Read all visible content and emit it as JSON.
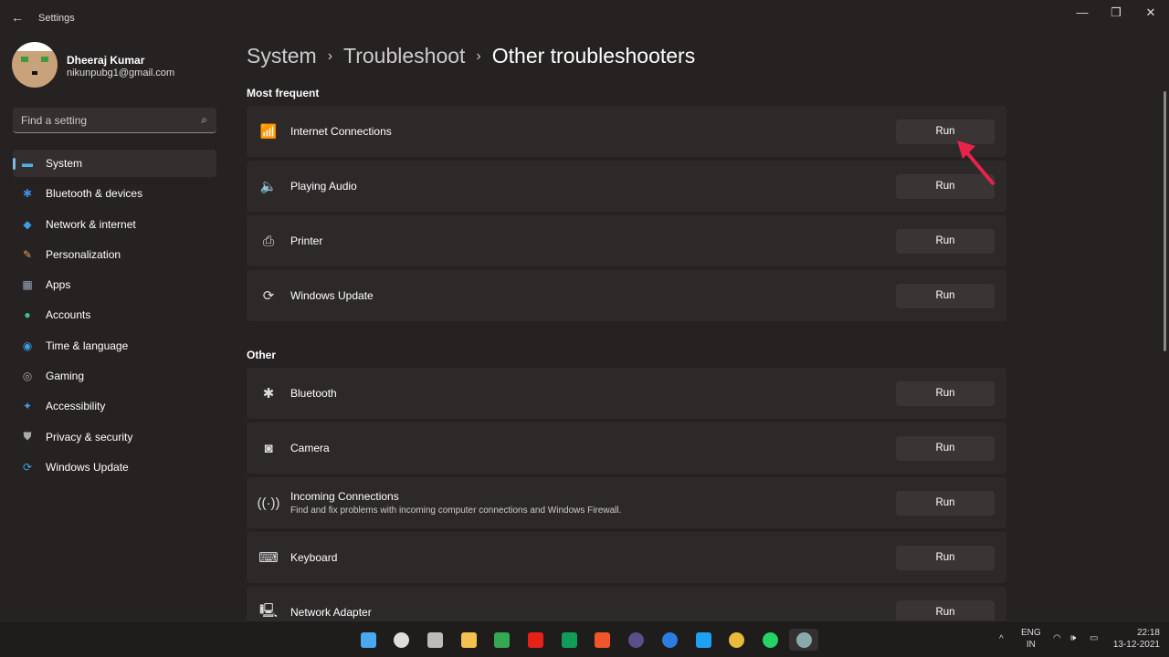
{
  "window": {
    "title": "Settings",
    "back": "←",
    "minimize": "—",
    "maximize": "❐",
    "close": "✕"
  },
  "user": {
    "name": "Dheeraj Kumar",
    "email": "nikunpubg1@gmail.com"
  },
  "search": {
    "placeholder": "Find a setting",
    "icon": "⌕"
  },
  "nav": [
    {
      "label": "System",
      "icon": "▬",
      "color": "#4cb2e8"
    },
    {
      "label": "Bluetooth & devices",
      "icon": "✱",
      "color": "#3a8ee6"
    },
    {
      "label": "Network & internet",
      "icon": "◆",
      "color": "#3aa0e6"
    },
    {
      "label": "Personalization",
      "icon": "✎",
      "color": "#e89a5a"
    },
    {
      "label": "Apps",
      "icon": "▦",
      "color": "#9ab"
    },
    {
      "label": "Accounts",
      "icon": "●",
      "color": "#3fc28a"
    },
    {
      "label": "Time & language",
      "icon": "◉",
      "color": "#3aa0e6"
    },
    {
      "label": "Gaming",
      "icon": "◎",
      "color": "#aaa"
    },
    {
      "label": "Accessibility",
      "icon": "✦",
      "color": "#3aa0e6"
    },
    {
      "label": "Privacy & security",
      "icon": "⛊",
      "color": "#aaa"
    },
    {
      "label": "Windows Update",
      "icon": "⟳",
      "color": "#3aa0e6"
    }
  ],
  "breadcrumb": [
    "System",
    "Troubleshoot",
    "Other troubleshooters"
  ],
  "breadcrumb_sep": "›",
  "sections": {
    "frequent": "Most frequent",
    "other": "Other"
  },
  "run_label": "Run",
  "frequent": [
    {
      "title": "Internet Connections",
      "icon": "📶"
    },
    {
      "title": "Playing Audio",
      "icon": "🔈"
    },
    {
      "title": "Printer",
      "icon": "⎙"
    },
    {
      "title": "Windows Update",
      "icon": "⟳"
    }
  ],
  "other": [
    {
      "title": "Bluetooth",
      "icon": "✱"
    },
    {
      "title": "Camera",
      "icon": "◙"
    },
    {
      "title": "Incoming Connections",
      "subtitle": "Find and fix problems with incoming computer connections and Windows Firewall.",
      "icon": "((·))"
    },
    {
      "title": "Keyboard",
      "icon": "⌨"
    },
    {
      "title": "Network Adapter",
      "icon": "🖳"
    }
  ],
  "taskbar": {
    "apps": [
      "start",
      "search",
      "task-view",
      "file-explorer",
      "google-drive",
      "youtube",
      "sheets",
      "brave",
      "bit",
      "c-app",
      "twitter",
      "chrome",
      "whatsapp",
      "settings"
    ],
    "tray": {
      "chevron": "^",
      "lang": "ENG",
      "region": "IN",
      "wifi": "◠",
      "volume": "🕪",
      "battery": "▭",
      "time": "22:18",
      "date": "13-12-2021"
    }
  }
}
